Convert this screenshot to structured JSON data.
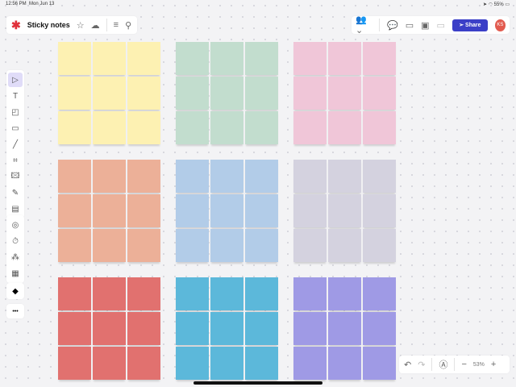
{
  "status": {
    "time": "12:56 PM",
    "date": "Mon Jun 13",
    "battery": "55%"
  },
  "header": {
    "title": "Sticky notes",
    "share_label": "Share",
    "avatar_initials": "KS",
    "accent": "#3b3fc7",
    "avatar_color": "#e25b4f",
    "logo_color": "#e0303a"
  },
  "toolbar": {
    "tools": [
      "select",
      "text",
      "sticky-note",
      "rectangle",
      "line",
      "frame",
      "image",
      "pen",
      "card"
    ],
    "tools2": [
      "templates",
      "timer",
      "reactions",
      "apps"
    ],
    "more": "•••"
  },
  "zoom": {
    "level": "53%"
  },
  "note_groups": [
    {
      "color": "#fdf1b2"
    },
    {
      "color": "#c2ddce"
    },
    {
      "color": "#f0c6d8"
    },
    {
      "color": "#ecb098"
    },
    {
      "color": "#b2cce8"
    },
    {
      "color": "#d4d2df"
    },
    {
      "color": "#e1716f"
    },
    {
      "color": "#5cb8da"
    },
    {
      "color": "#9f9ae5"
    }
  ]
}
